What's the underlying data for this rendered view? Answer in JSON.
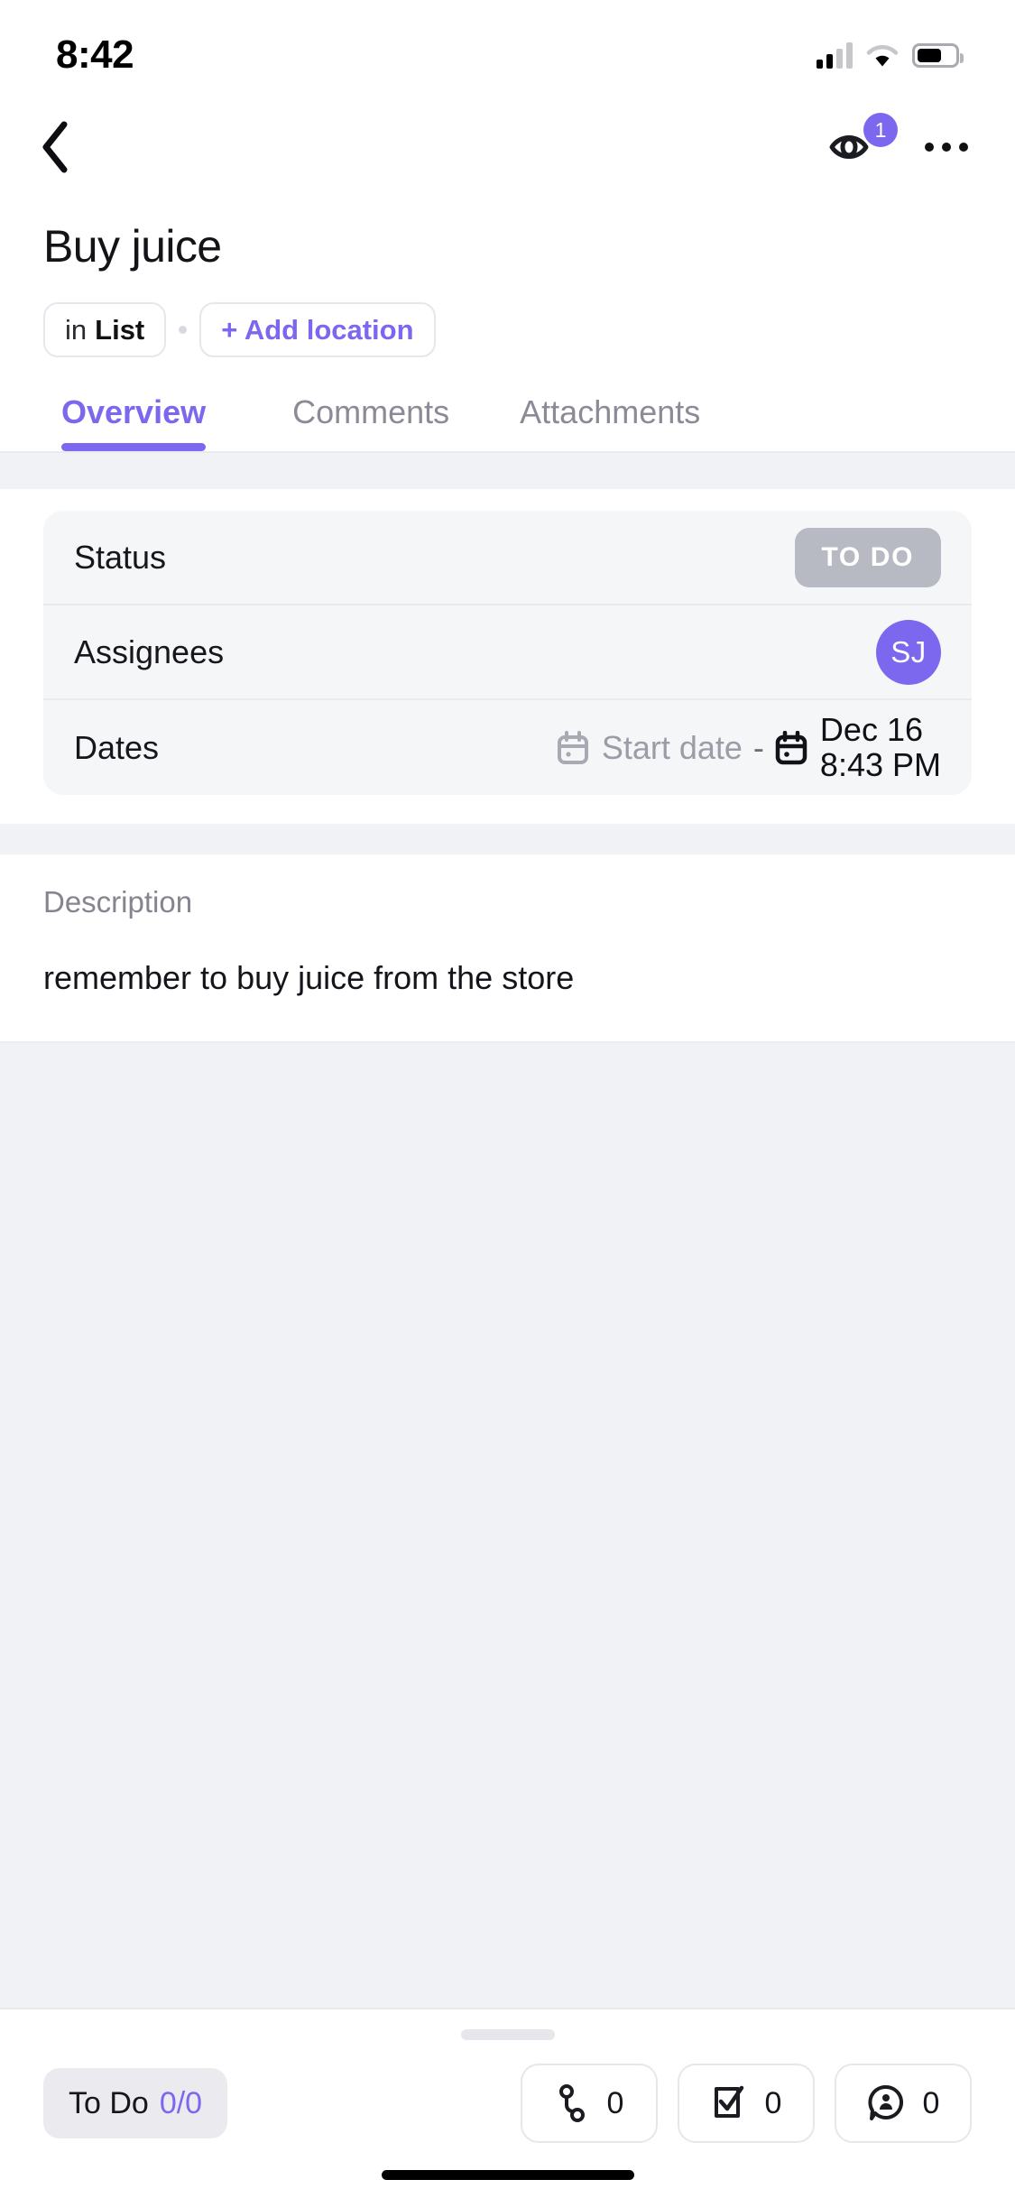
{
  "status_bar": {
    "time": "8:42",
    "cellular_icon": "cellular-signal-icon",
    "wifi_icon": "wifi-icon",
    "battery_icon": "battery-icon"
  },
  "nav": {
    "back_icon": "back-chevron-icon",
    "watch_icon": "eye-watch-icon",
    "watch_count": "1",
    "more_icon": "more-options-icon"
  },
  "task": {
    "title": "Buy juice",
    "location_prefix": "in",
    "location_name": "List",
    "add_location_label": "+ Add location"
  },
  "tabs": [
    {
      "label": "Overview",
      "active": true
    },
    {
      "label": "Comments",
      "active": false
    },
    {
      "label": "Attachments",
      "active": false
    }
  ],
  "details": {
    "status": {
      "label": "Status",
      "value": "TO DO",
      "color": "#b7bac2"
    },
    "assignees": {
      "label": "Assignees",
      "avatar_initials": "SJ",
      "avatar_color": "#7b68ee"
    },
    "dates": {
      "label": "Dates",
      "start_placeholder": "Start date",
      "separator": "-",
      "due_date": "Dec 16",
      "due_time": "8:43 PM",
      "start_calendar_icon": "calendar-icon",
      "due_calendar_icon": "calendar-icon"
    }
  },
  "description": {
    "label": "Description",
    "body": "remember to buy juice from the store"
  },
  "bottom_bar": {
    "status_label": "To Do",
    "subtask_progress": "0/0",
    "actions": [
      {
        "icon": "dependency-link-icon",
        "count": "0"
      },
      {
        "icon": "subtask-checkbox-icon",
        "count": "0"
      },
      {
        "icon": "mention-comment-icon",
        "count": "0"
      }
    ]
  },
  "theme": {
    "accent": "#7b68ee",
    "muted_text": "#8a8b96",
    "card_bg": "#f5f6f8",
    "page_bg": "#f1f2f6"
  }
}
